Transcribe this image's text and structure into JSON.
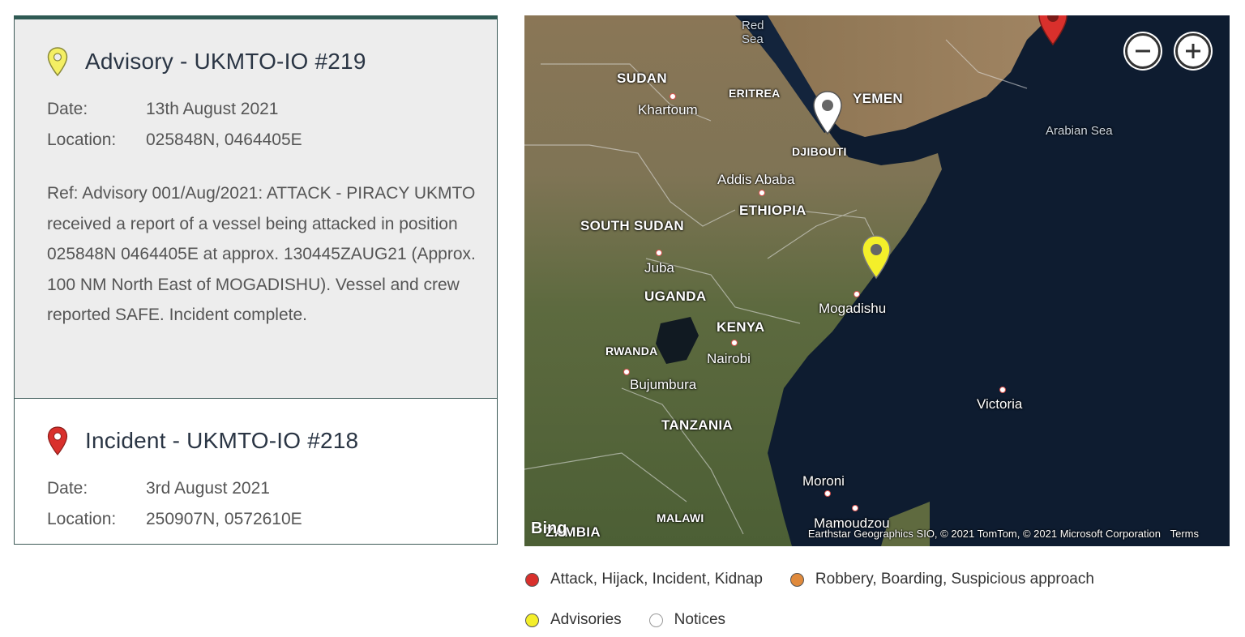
{
  "incidents": [
    {
      "title": "Advisory - UKMTO-IO #219",
      "pin_color": "#f4ef63",
      "date_label": "Date:",
      "date": "13th August 2021",
      "location_label": "Location:",
      "location": "025848N, 0464405E",
      "description": "Ref: Advisory 001/Aug/2021: ATTACK - PIRACY UKMTO received a report of a vessel being attacked in position 025848N 0464405E at approx. 130445ZAUG21 (Approx. 100 NM North East of MOGADISHU). Vessel and crew reported SAFE. Incident complete."
    },
    {
      "title": "Incident - UKMTO-IO #218",
      "pin_color": "#d9302c",
      "date_label": "Date:",
      "date": "3rd August 2021",
      "location_label": "Location:",
      "location": "250907N, 0572610E"
    }
  ],
  "map": {
    "labels": {
      "red_sea": "Red\nSea",
      "sudan": "SUDAN",
      "eritrea": "ERITREA",
      "yemen": "YEMEN",
      "khartoum": "Khartoum",
      "djibouti": "DJIBOUTI",
      "arabian_sea": "Arabian Sea",
      "addis_ababa": "Addis Ababa",
      "ethiopia": "ETHIOPIA",
      "south_sudan": "SOUTH SUDAN",
      "juba": "Juba",
      "uganda": "UGANDA",
      "mogadishu": "Mogadishu",
      "kenya": "KENYA",
      "rwanda": "RWANDA",
      "nairobi": "Nairobi",
      "bujumbura": "Bujumbura",
      "victoria": "Victoria",
      "tanzania": "TANZANIA",
      "moroni": "Moroni",
      "malawi": "MALAWI",
      "mamoudzou": "Mamoudzou",
      "zambia": "ZAMBIA"
    },
    "bing_logo": "Bing",
    "attribution": "Earthstar Geographics SIO, © 2021 TomTom, © 2021 Microsoft Corporation",
    "terms": "Terms",
    "zoom_out_icon": "minus-icon",
    "zoom_in_icon": "plus-icon"
  },
  "legend": [
    {
      "label": "Attack, Hijack, Incident, Kidnap",
      "color": "#d9302c"
    },
    {
      "label": "Robbery, Boarding, Suspicious approach",
      "color": "#e08a3c"
    },
    {
      "label": "Advisories",
      "color": "#f4ef2a"
    },
    {
      "label": "Notices",
      "color": "#ffffff"
    }
  ]
}
